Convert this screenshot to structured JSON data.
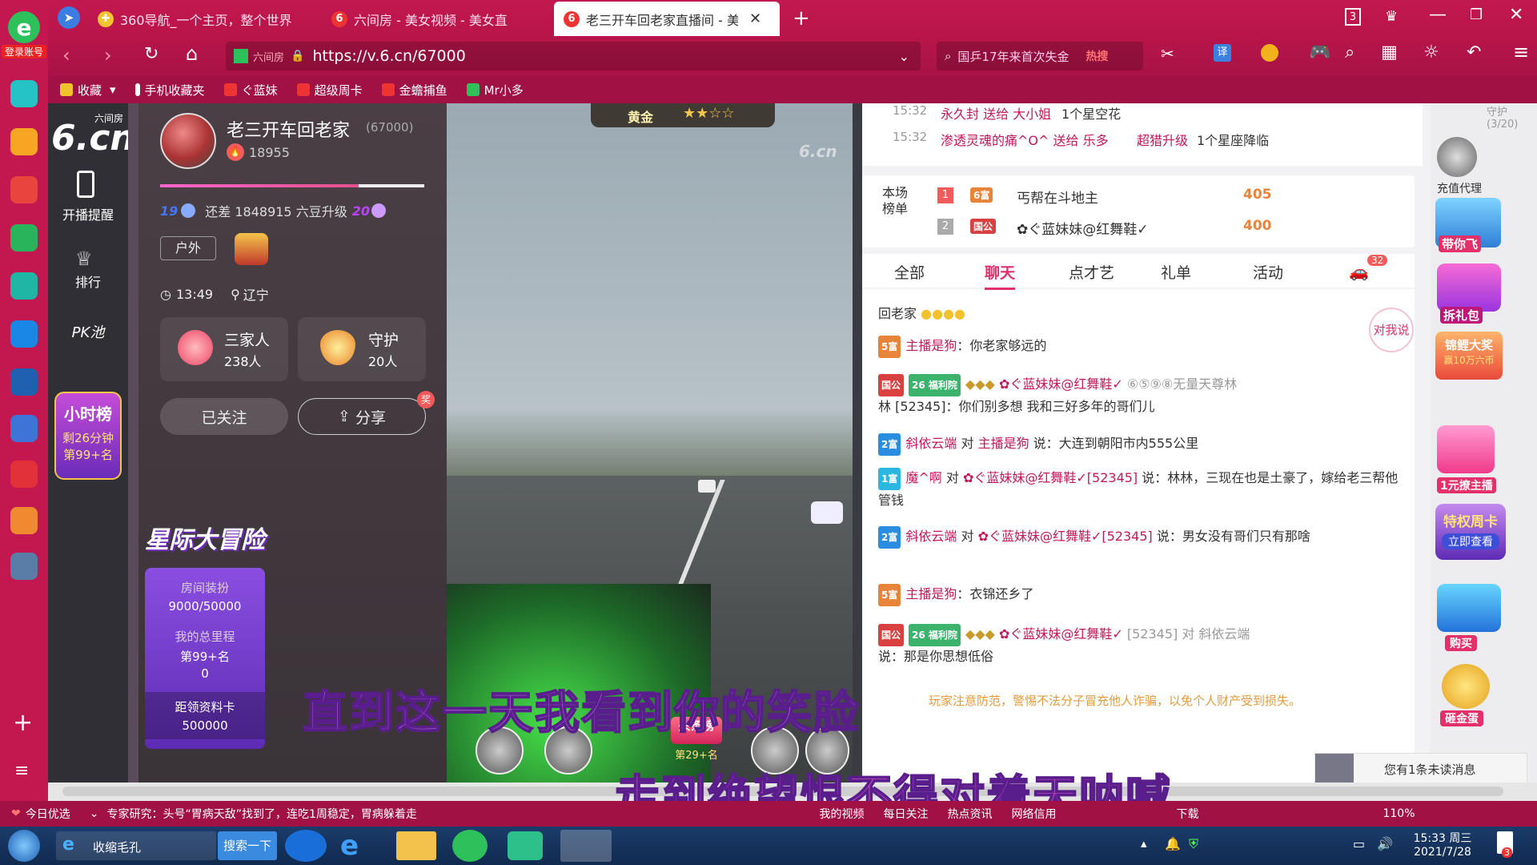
{
  "browser": {
    "logo_label": "登录账号",
    "tabs": [
      {
        "label": "360导航_一个主页，整个世界"
      },
      {
        "label": "六间房 - 美女视频 - 美女直"
      },
      {
        "label": "老三开车回老家直播间 - 美女"
      }
    ],
    "tab_count": "3",
    "address_prefix": "六间房",
    "url": "https://v.6.cn/67000",
    "search_text": "国乒17年来首次失金",
    "search_hot": "热搜",
    "translate_label": "译",
    "favorites": [
      "收藏",
      "手机收藏夹",
      "ぐ蓝妹",
      "超级周卡",
      "金蟾捕鱼",
      "Mr小多"
    ]
  },
  "site": {
    "logo_top": "六间房",
    "logo_main": "6.cn",
    "nav": [
      {
        "label": "开播提醒"
      },
      {
        "label": "排行"
      },
      {
        "label": "PK池"
      }
    ],
    "hour_rank_title": "小时榜",
    "hour_rank_time": "剩26分钟",
    "hour_rank_pos": "第99+名"
  },
  "anchor": {
    "name": "老三开车回老家",
    "room_id": "(67000)",
    "fans": "18955",
    "level_from": "19",
    "level_to": "20",
    "level_gap": "还差 1848915 六豆升级",
    "tag": "户外",
    "time": "13:49",
    "location": "辽宁",
    "family_label": "三家人",
    "family_count": "238人",
    "guard_label": "守护",
    "guard_count": "20人",
    "followed_label": "已关注",
    "share_label": "分享",
    "share_badge": "奖"
  },
  "adventure": {
    "title": "星际大冒险",
    "decor_label": "房间装扮",
    "decor_value": "9000/50000",
    "mileage_label": "我的总里程",
    "mileage_rank": "第99+名",
    "mileage_value": "0",
    "card_label": "距领资料卡",
    "card_value": "500000"
  },
  "video": {
    "top_badge": "黄金",
    "watermark": "6.cn",
    "headline_label": "头条榜",
    "headline_rank": "第29+名",
    "subtitle1": "直到这一天我看到你的笑脸",
    "subtitle2": "走到绝望恨不得对着天呐喊"
  },
  "gifts": [
    {
      "time": "15:32",
      "text": "永久封 送给 大小姐",
      "gift": "1个星空花"
    },
    {
      "time": "15:32",
      "text": "渗透灵魂的痛^O^ 送给 乐多",
      "user2": "超猎升级",
      "gift": "1个星座降临"
    }
  ],
  "scene_rank": {
    "label": "本场榜单",
    "rows": [
      {
        "rank": "1",
        "badge": "6富",
        "name": "丐帮在斗地主",
        "score": "405"
      },
      {
        "rank": "2",
        "badge": "国公",
        "name": "✿ぐ蓝妹妹@红舞鞋✓",
        "score": "400"
      }
    ]
  },
  "chat_tabs": [
    {
      "label": "全部"
    },
    {
      "label": "聊天"
    },
    {
      "label": "点才艺"
    },
    {
      "label": "礼单"
    },
    {
      "label": "活动"
    }
  ],
  "chat_tab_badge": "32",
  "chat_bubble": "对我说",
  "chat": [
    {
      "badge": "",
      "name": "",
      "text": "回老家"
    },
    {
      "badge": "5富",
      "name": "主播是狗",
      "text": "：你老家够远的"
    },
    {
      "badge": "国公",
      "club": "福利院",
      "club_level": "26",
      "name": "✿ぐ蓝妹妹@红舞鞋✓",
      "extra": "⑥⑤⑨⑧无量天尊林",
      "text": "林 [52345]：你们别多想 我和三好多年的哥们儿"
    },
    {
      "badge": "2富",
      "name": "斜依云端",
      "to": "主播是狗",
      "text": "说：大连到朝阳市内555公里"
    },
    {
      "badge": "1富",
      "name": "魔^啊",
      "to": "✿ぐ蓝妹妹@红舞鞋✓[52345]",
      "text": "说：林林，三现在也是土豪了，嫁给老三帮他管钱"
    },
    {
      "badge": "2富",
      "name": "斜依云端",
      "to": "✿ぐ蓝妹妹@红舞鞋✓[52345]",
      "text": "说：男女没有哥们只有那啥"
    },
    {
      "badge": "5富",
      "name": "主播是狗",
      "text": "：衣锦还乡了"
    },
    {
      "badge": "国公",
      "club": "福利院",
      "club_level": "26",
      "name": "✿ぐ蓝妹妹@红舞鞋✓",
      "to": "[52345] 对 斜依云端",
      "text": "说：那是你思想低俗"
    }
  ],
  "notice": "玩家注意防范，警惕不法分子冒充他人诈骗，以免个人财产受到损失。",
  "far_right": {
    "guard_top": "守护(3/20)",
    "labels": [
      "充值代理",
      "带你飞",
      "拆礼包",
      "锦鲤大奖",
      "赢10万六币",
      "1元撩主播",
      "特权周卡",
      "立即查看",
      "购买",
      "砸金蛋"
    ],
    "unread": "您有1条未读消息"
  },
  "status": {
    "today": "今日优选",
    "news": "专家研究：头号“胃病天敌”找到了，连吃1周稳定，胃病躲着走",
    "items": [
      "我的视频",
      "每日关注",
      "热点资讯",
      "网络信用",
      "下载"
    ],
    "zoom": "110%"
  },
  "taskbar": {
    "ie_label": "收缩毛孔",
    "search_btn": "搜索一下",
    "time": "15:33 周三",
    "date": "2021/7/28",
    "notify_count": "3"
  }
}
